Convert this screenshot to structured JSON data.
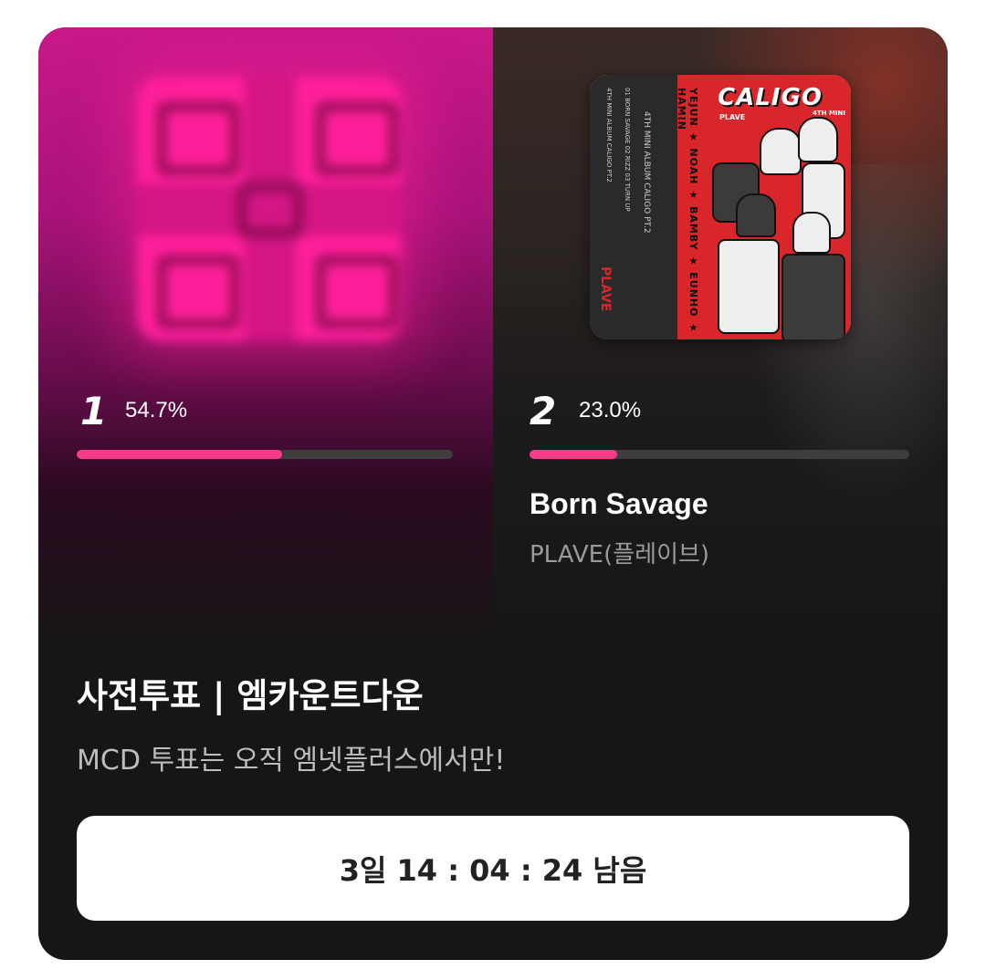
{
  "candidates": [
    {
      "rank": "1",
      "percent": "54.7%",
      "progress": 0.547,
      "art_icon": "album-cover-pink"
    },
    {
      "rank": "2",
      "percent": "23.0%",
      "progress": 0.23,
      "title": "Born Savage",
      "artist": "PLAVE(플레이브)",
      "art_icon": "album-cover-caligo",
      "art_text": {
        "logo": "CALIGO",
        "logo_sub": "PLAVE",
        "logo_sub2": "4TH MINI",
        "spine_members": "YEJUN ★ NOAH ★ BAMBY ★ EUNHO ★ HAMIN",
        "spine_brand": "PLAVE",
        "spine_small_1": "4TH MINI ALBUM CALIGO PT.2",
        "spine_small_2": "01 BORN SAVAGE 02 RIZZ 03 TURN UP"
      }
    }
  ],
  "vote": {
    "title": "사전투표 | 엠카운트다운",
    "description": "MCD 투표는 오직 엠넷플러스에서만!",
    "countdown": "3일 14 : 04 : 24 남음"
  },
  "colors": {
    "accent": "#fa3c88",
    "card_bg": "#161616",
    "track": "#3d3d3d"
  }
}
